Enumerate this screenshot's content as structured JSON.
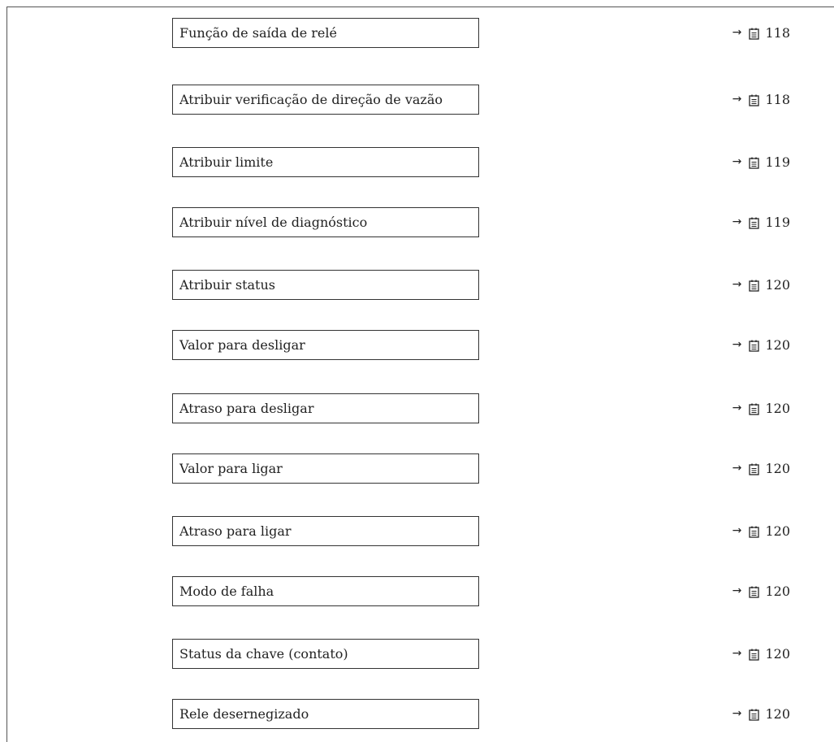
{
  "parameters": [
    {
      "label": "Função de saída de relé",
      "arrow": "→",
      "page": "118",
      "icon": "page-reference-icon"
    },
    {
      "label": "Atribuir verificação de direção de vazão",
      "arrow": "→",
      "page": "118",
      "icon": "page-reference-icon"
    },
    {
      "label": "Atribuir limite",
      "arrow": "→",
      "page": "119",
      "icon": "page-reference-icon"
    },
    {
      "label": "Atribuir nível de diagnóstico",
      "arrow": "→",
      "page": "119",
      "icon": "page-reference-icon"
    },
    {
      "label": "Atribuir status",
      "arrow": "→",
      "page": "120",
      "icon": "page-reference-icon"
    },
    {
      "label": "Valor para desligar",
      "arrow": "→",
      "page": "120",
      "icon": "page-reference-icon"
    },
    {
      "label": "Atraso para desligar",
      "arrow": "→",
      "page": "120",
      "icon": "page-reference-icon"
    },
    {
      "label": "Valor para ligar",
      "arrow": "→",
      "page": "120",
      "icon": "page-reference-icon"
    },
    {
      "label": "Atraso para ligar",
      "arrow": "→",
      "page": "120",
      "icon": "page-reference-icon"
    },
    {
      "label": "Modo de falha",
      "arrow": "→",
      "page": "120",
      "icon": "page-reference-icon"
    },
    {
      "label": "Status da chave (contato)",
      "arrow": "→",
      "page": "120",
      "icon": "page-reference-icon"
    },
    {
      "label": "Rele desernegizado",
      "arrow": "→",
      "page": "120",
      "icon": "page-reference-icon"
    }
  ],
  "colors": {
    "text": "#222222",
    "border": "#333333",
    "frame": "#555555",
    "background": "#ffffff"
  }
}
